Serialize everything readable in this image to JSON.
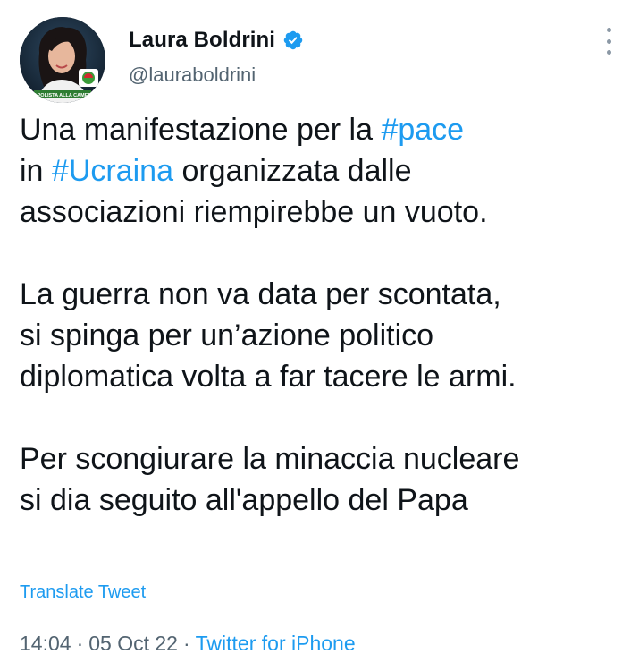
{
  "author": {
    "display_name": "Laura Boldrini",
    "handle": "@lauraboldrini",
    "avatar_icon": "profile-photo",
    "verified_icon": "verified-badge-icon",
    "avatar_caption": "CAPOLISTA ALLA CAMERA"
  },
  "tweet": {
    "paragraphs": [
      {
        "lines": [
          [
            {
              "text": "Una manifestazione per la "
            },
            {
              "text": "#pace",
              "hashtag": true
            }
          ],
          [
            {
              "text": "in "
            },
            {
              "text": "#Ucraina",
              "hashtag": true
            },
            {
              "text": " organizzata dalle"
            }
          ],
          [
            {
              "text": "associazioni riempirebbe un vuoto."
            }
          ]
        ]
      },
      {
        "lines": [
          [
            {
              "text": "La guerra non va data per scontata,"
            }
          ],
          [
            {
              "text": "si spinga per un’azione politico"
            }
          ],
          [
            {
              "text": "diplomatica volta a far tacere le armi."
            }
          ]
        ]
      },
      {
        "lines": [
          [
            {
              "text": "Per scongiurare la minaccia nucleare"
            }
          ],
          [
            {
              "text": "si dia seguito all'appello del Papa"
            }
          ]
        ]
      }
    ],
    "translate_label": "Translate Tweet",
    "time": "14:04",
    "separator": "·",
    "date": "05 Oct 22",
    "source": "Twitter for iPhone"
  },
  "colors": {
    "link": "#1d9bf0",
    "text": "#0f1419",
    "secondary": "#536471"
  }
}
